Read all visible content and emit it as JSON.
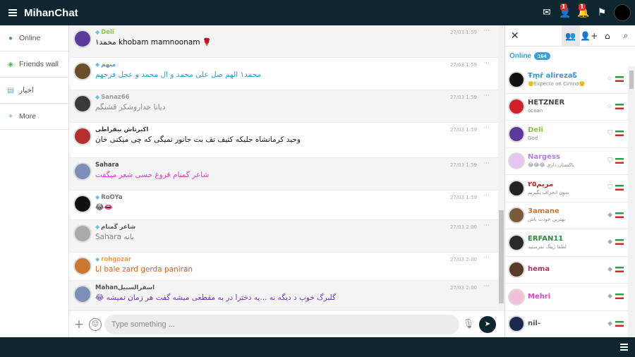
{
  "app": {
    "title": "MihanChat"
  },
  "top_icons": [
    {
      "name": "mail-icon",
      "glyph": "✉",
      "badge": ""
    },
    {
      "name": "friend-request-icon",
      "glyph": "👤",
      "badge": "1"
    },
    {
      "name": "notification-bell-icon",
      "glyph": "🔔",
      "badge": "1"
    },
    {
      "name": "report-flag-icon",
      "glyph": "⚑",
      "badge": ""
    }
  ],
  "nav": [
    {
      "icon": "●",
      "icon_color": "#3cb043",
      "label": "Online"
    },
    {
      "icon": "◈",
      "icon_color": "#3cb043",
      "label": "Friends wall"
    },
    {
      "icon": "▤",
      "icon_color": "#68a0d8",
      "label": "اخبار"
    },
    {
      "icon": "+",
      "icon_color": "#3aa0d6",
      "label": "More"
    }
  ],
  "messages": [
    {
      "user": "Deli",
      "user_color": "#8bc34a",
      "text": "محمد۱ khobam mamnoonam 🌹",
      "text_color": "#111111",
      "time": "27/03 1:59",
      "avatar": "#5b3a9b",
      "gem": true
    },
    {
      "user": "مبهم",
      "user_color": "#3aa0d6",
      "text": "محمد۱ الهم صل علی محمد و ال محمد و عجل فرجهم",
      "text_color": "#2e9bd6",
      "time": "27/03 1:59",
      "avatar": "#6b4f2a",
      "gem": true
    },
    {
      "user": "Sanaz66",
      "user_color": "#999999",
      "text": "دیانا خداروشکر قشنگم",
      "text_color": "#888888",
      "time": "27/03 1:59",
      "avatar": "#3a3a3a",
      "gem": true
    },
    {
      "user": "اکبرتاش بیقراطی",
      "user_color": "#333333",
      "text": "وحید کرمانشاه جلیکه کثیف تف بت جانور نمیگی که چی میکنی خان",
      "text_color": "#111111",
      "time": "27/03 1:59",
      "avatar": "#b33030",
      "gem": false
    },
    {
      "user": "Sahara",
      "user_color": "#444444",
      "text": "شاعر گمنام فروغ حسی شعر میگفت",
      "text_color": "#e040c8",
      "time": "27/03 1:59",
      "avatar": "#7c8fb8",
      "gem": false
    },
    {
      "user": "RoOYa",
      "user_color": "#777777",
      "text": "😂👄",
      "text_color": "#111111",
      "time": "27/03 1:59",
      "avatar": "#111111",
      "gem": true
    },
    {
      "user": "شاعر گمنام",
      "user_color": "#555555",
      "text": "Sahara بانه",
      "text_color": "#888888",
      "time": "27/03 2:00",
      "avatar": "#aaaaaa",
      "gem": true
    },
    {
      "user": "rohgozar",
      "user_color": "#f0a030",
      "text": "انا bale zard gerda paniran",
      "text_color": "#e06020",
      "time": "27/03 2:00",
      "avatar": "#c87830",
      "gem": true
    },
    {
      "user": "Mahanاسفرالسبیل",
      "user_color": "#555555",
      "text": "😂 گلبرگ خوب د دیگه نه ...یه دخترا در به مقطعی میشه گفت هر زمان نمیشه",
      "text_color": "#6a3ab8",
      "time": "27/03 2:00",
      "avatar": "#7c8fb8",
      "gem": false
    }
  ],
  "input": {
    "placeholder": "Type something ..."
  },
  "right_tabs": [
    {
      "name": "close-panel-icon",
      "glyph": "✕"
    },
    {
      "name": "users-group-icon",
      "glyph": "👥"
    },
    {
      "name": "add-friend-icon",
      "glyph": "👤+"
    },
    {
      "name": "home-icon",
      "glyph": "⌂"
    },
    {
      "name": "search-icon",
      "glyph": "⌕"
    }
  ],
  "online": {
    "label": "Online",
    "count": "164"
  },
  "users": [
    {
      "name": "Ŧṃṙ alirezaᏋ",
      "name_color": "#2e9bd6",
      "mood": "🙂Expecto on Cimno🙂",
      "avatar": "#111111",
      "rank": "☆"
    },
    {
      "name": "HETZNER",
      "name_color": "#444444",
      "mood": "ocean",
      "avatar": "#d0202a",
      "rank": "☆"
    },
    {
      "name": "Deli",
      "name_color": "#8bc34a",
      "mood": "God",
      "avatar": "#5b3a9b",
      "rank": "⛉"
    },
    {
      "name": "Nargess",
      "name_color": "#b07ce0",
      "mood": "😂😂😂 پاکستان داری",
      "avatar": "#e6c6f0",
      "rank": "⛉"
    },
    {
      "name": "مریم۲۵",
      "name_color": "#e02020",
      "mood": "بدون انحراف یگیریم",
      "avatar": "#222222",
      "rank": "⛉"
    },
    {
      "name": "3amane",
      "name_color": "#c87830",
      "mood": "بهترین خودت باش",
      "avatar": "#7a5a3a",
      "rank": "◆"
    },
    {
      "name": "ERFAN11",
      "name_color": "#2e8b3e",
      "mood": "لطفا ژینگ نفرستید",
      "avatar": "#2a2a2a",
      "rank": "◆"
    },
    {
      "name": "hema",
      "name_color": "#b03060",
      "mood": "",
      "avatar": "#5a3a2a",
      "rank": "◆"
    },
    {
      "name": "Mehri",
      "name_color": "#e040c8",
      "mood": "",
      "avatar": "#f0c0d8",
      "rank": "◆"
    },
    {
      "name": "nil-",
      "name_color": "#555555",
      "mood": "",
      "avatar": "#1a2a4a",
      "rank": "◆"
    }
  ]
}
